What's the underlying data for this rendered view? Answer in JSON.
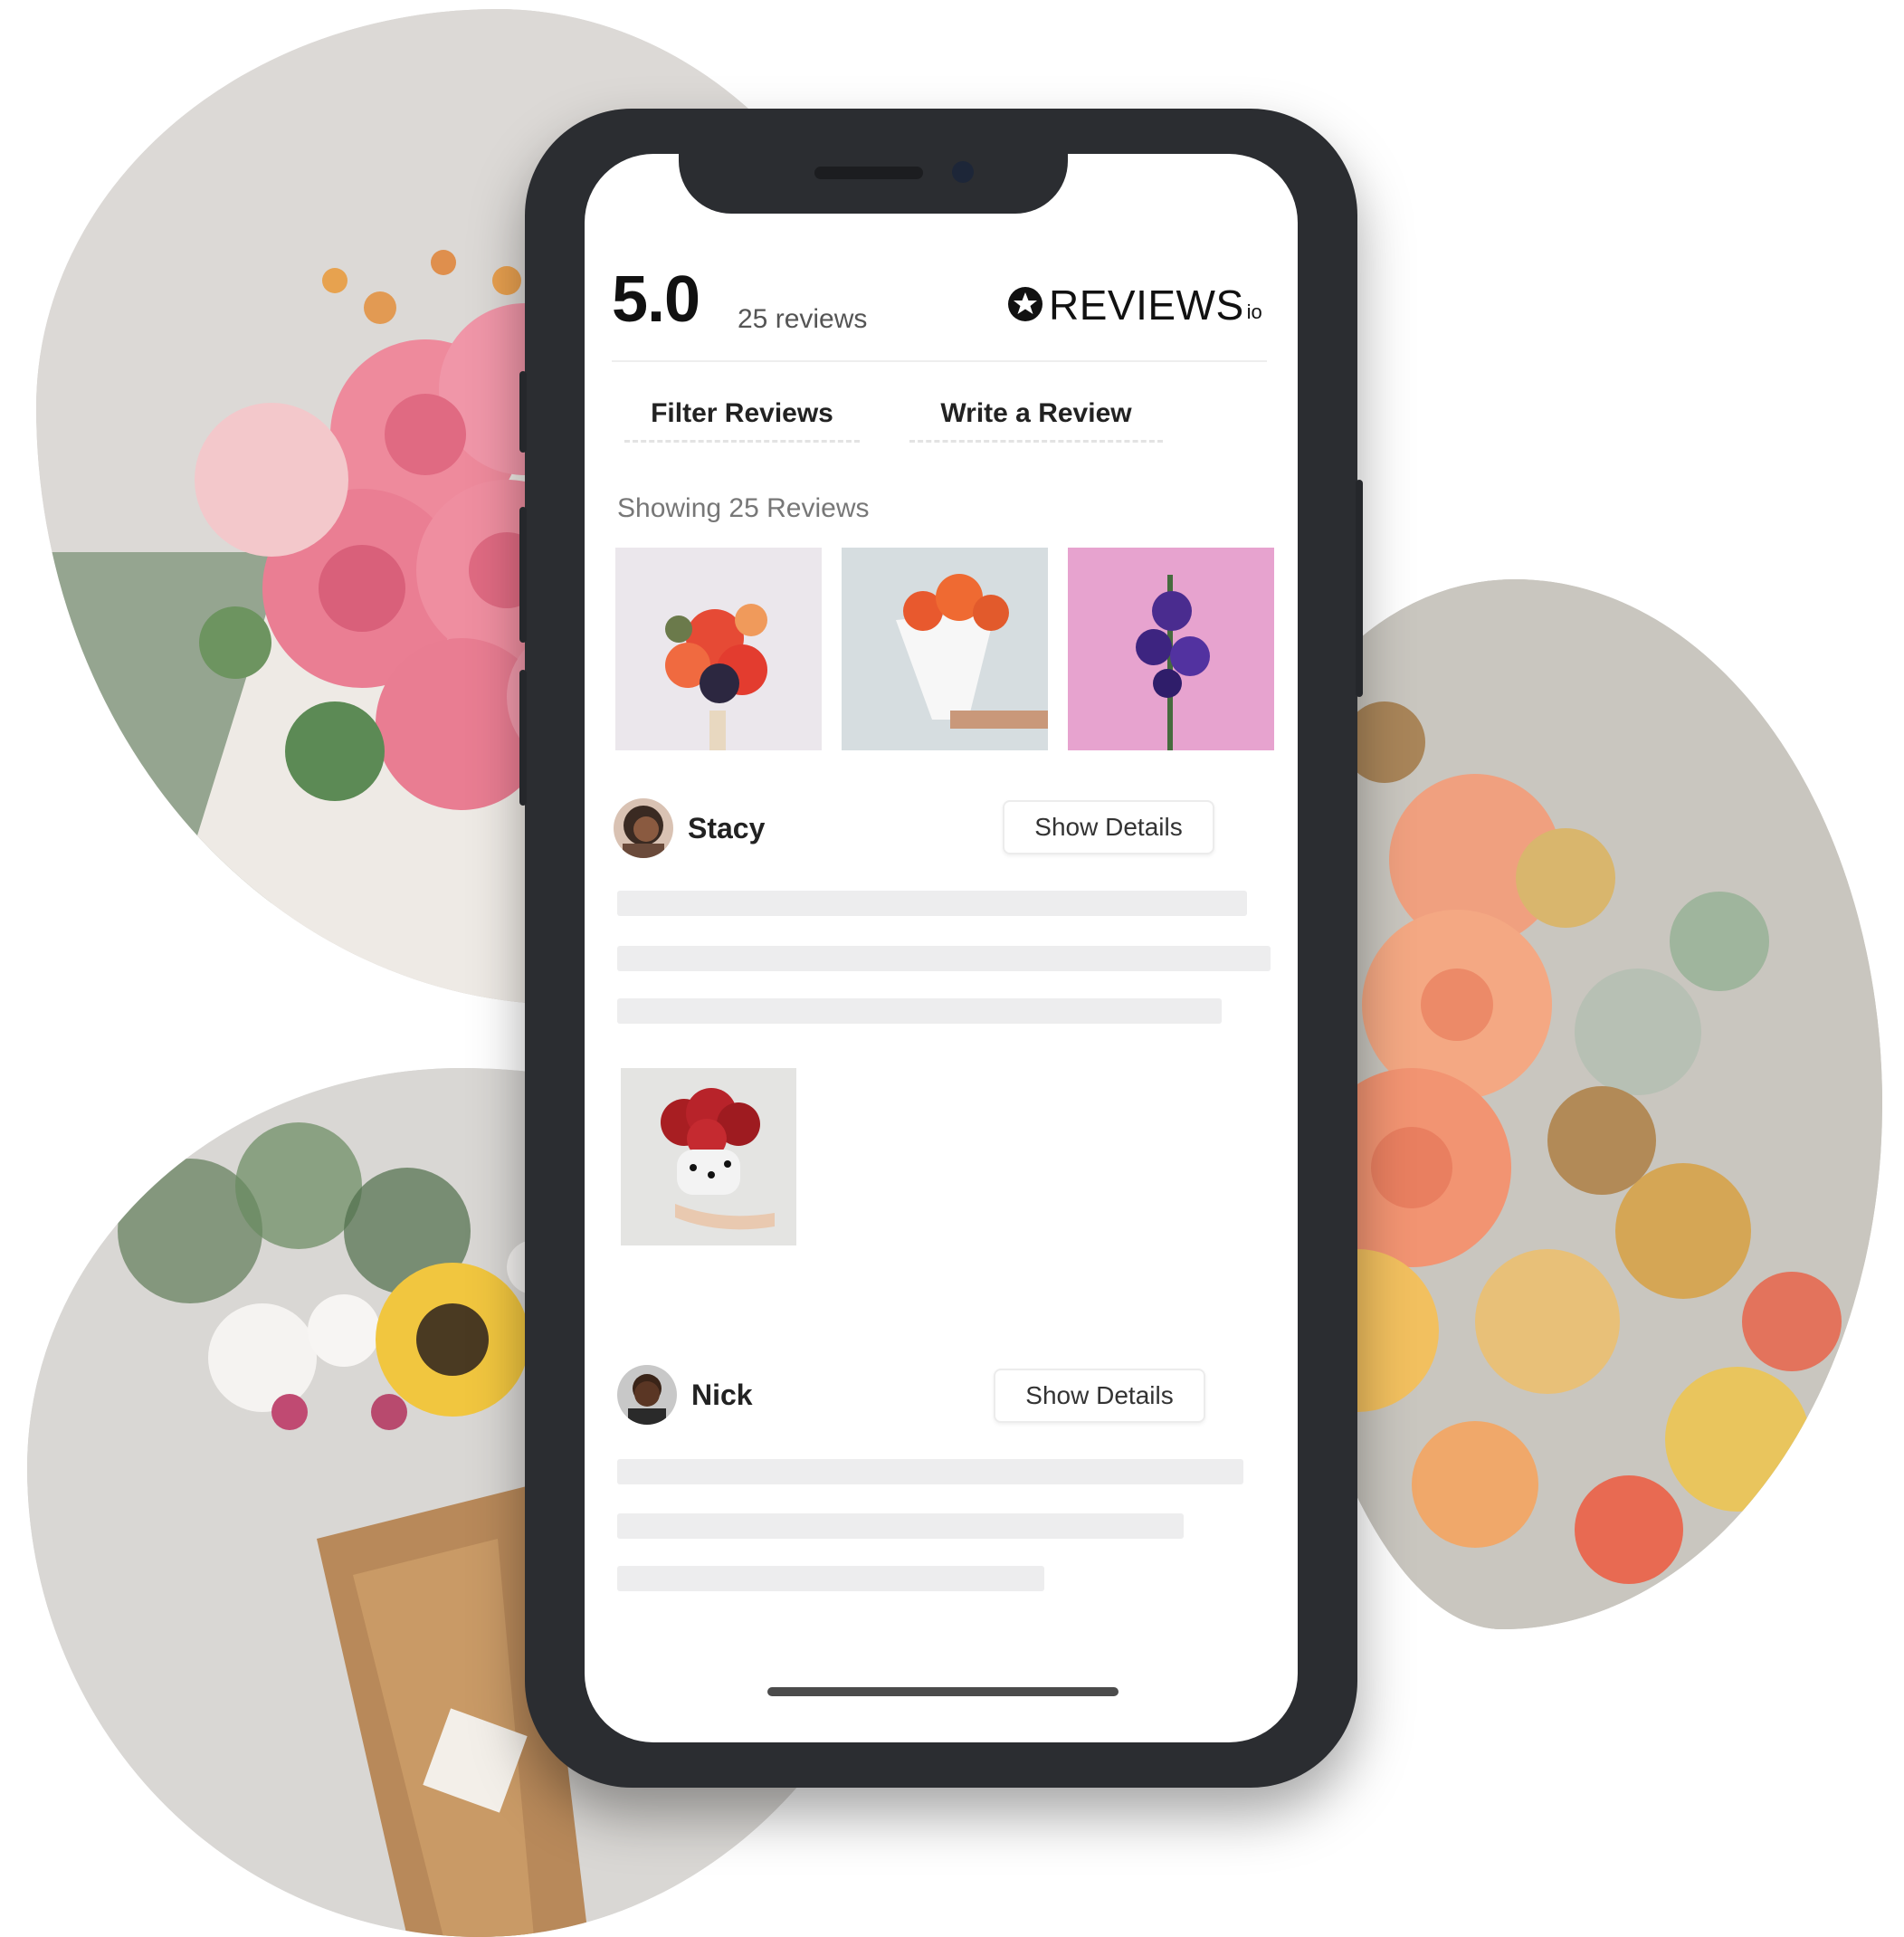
{
  "summary": {
    "rating": "5.0",
    "review_count": "25 reviews"
  },
  "brand": {
    "name": "REVIEWS",
    "suffix": "io",
    "icon": "star-badge-icon"
  },
  "tabs": {
    "filter": "Filter Reviews",
    "write": "Write a Review"
  },
  "showing_label": "Showing 25 Reviews",
  "gallery": [
    "orange-red bouquet photo",
    "orange flowers in white paper photo",
    "purple flowers on pink photo"
  ],
  "reviews": [
    {
      "name": "Stacy",
      "button": "Show Details",
      "photo": "red roses in polka-dot vase"
    },
    {
      "name": "Nick",
      "button": "Show Details"
    }
  ],
  "colors": {
    "phone_frame": "#2b2d31",
    "skeleton": "#ededee",
    "text_primary": "#111111",
    "text_muted": "#777777"
  }
}
